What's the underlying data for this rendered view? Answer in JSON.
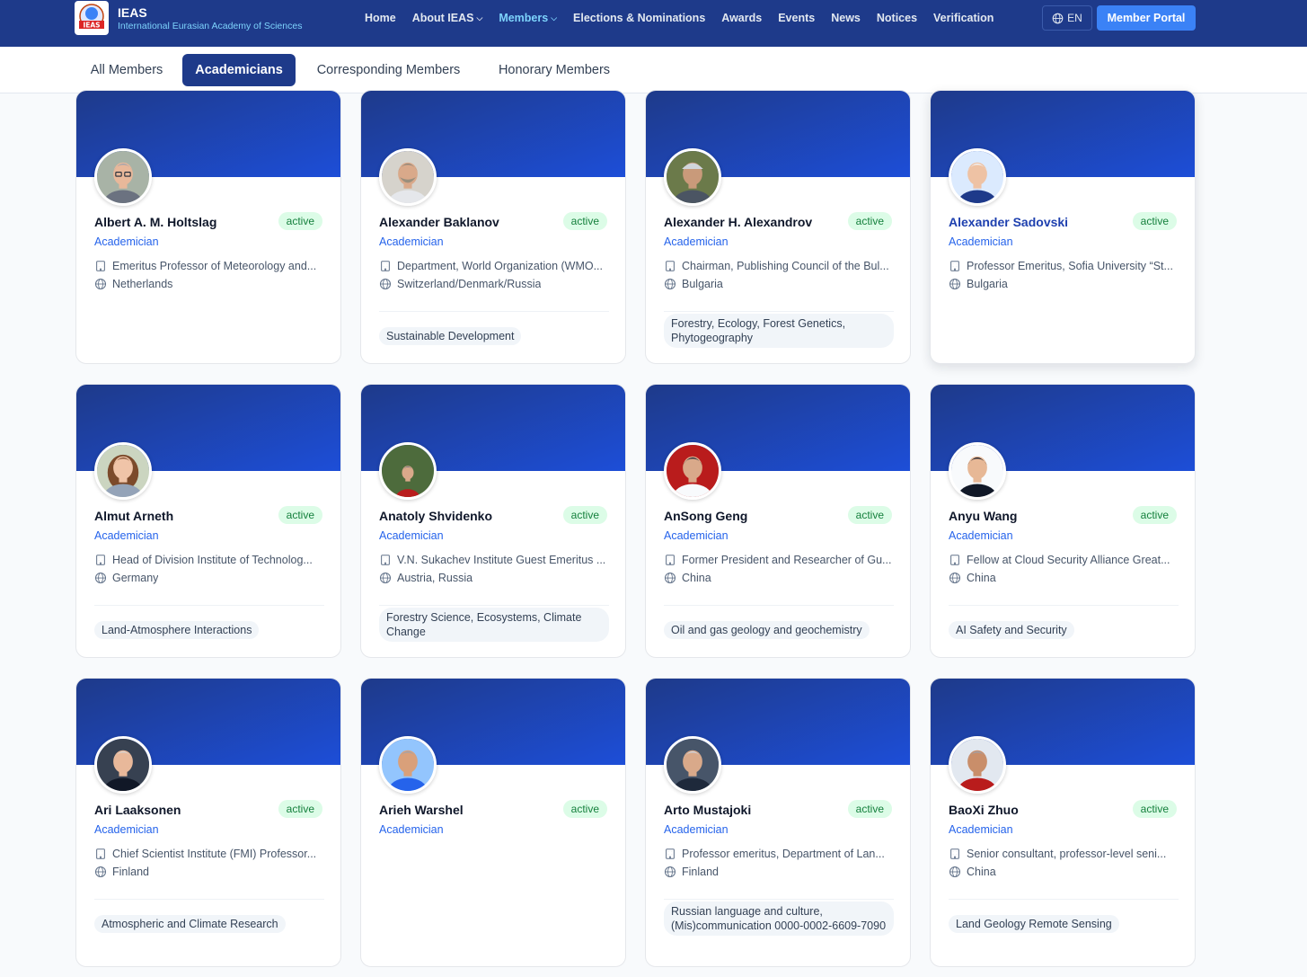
{
  "header": {
    "logo_text": "IEAS",
    "brand_title": "IEAS",
    "brand_subtitle": "International Eurasian Academy of Sciences",
    "nav": [
      {
        "label": "Home",
        "dropdown": false,
        "active": false
      },
      {
        "label": "About IEAS",
        "dropdown": true,
        "active": false
      },
      {
        "label": "Members",
        "dropdown": true,
        "active": true
      },
      {
        "label": "Elections & Nominations",
        "dropdown": false,
        "active": false
      },
      {
        "label": "Awards",
        "dropdown": false,
        "active": false
      },
      {
        "label": "Events",
        "dropdown": false,
        "active": false
      },
      {
        "label": "News",
        "dropdown": false,
        "active": false
      },
      {
        "label": "Notices",
        "dropdown": false,
        "active": false
      },
      {
        "label": "Verification",
        "dropdown": false,
        "active": false
      }
    ],
    "language": "EN",
    "portal_label": "Member Portal"
  },
  "tabs": [
    {
      "label": "All Members",
      "active": false
    },
    {
      "label": "Academicians",
      "active": true
    },
    {
      "label": "Corresponding Members",
      "active": false
    },
    {
      "label": "Honorary Members",
      "active": false
    }
  ],
  "members": [
    {
      "name": "Albert A. M. Holtslag",
      "status": "active",
      "role": "Academician",
      "position": "Emeritus Professor of Meteorology and...",
      "country": "Netherlands",
      "tags": [],
      "avatar": "gray-hair-glasses"
    },
    {
      "name": "Alexander Baklanov",
      "status": "active",
      "role": "Academician",
      "position": "Department, World Organization (WMO...",
      "country": "Switzerland/Denmark/Russia",
      "tags": [
        "Sustainable Development"
      ],
      "avatar": "bald-beard"
    },
    {
      "name": "Alexander H. Alexandrov",
      "status": "active",
      "role": "Academician",
      "position": "Chairman, Publishing Council of the Bul...",
      "country": "Bulgaria",
      "tags": [
        "Forestry, Ecology, Forest Genetics, Phytogeography"
      ],
      "avatar": "outdoor-cap"
    },
    {
      "name": "Alexander Sadovski",
      "status": "active",
      "role": "Academician",
      "position": "Professor Emeritus, Sofia University “St...",
      "country": "Bulgaria",
      "tags": [],
      "avatar": "white-hair-suit"
    },
    {
      "name": "Almut Arneth",
      "status": "active",
      "role": "Academician",
      "position": "Head of Division Institute of Technolog...",
      "country": "Germany",
      "tags": [
        "Land-Atmosphere Interactions"
      ],
      "avatar": "woman-brown-hair"
    },
    {
      "name": "Anatoly Shvidenko",
      "status": "active",
      "role": "Academician",
      "position": "V.N. Sukachev Institute Guest Emeritus ...",
      "country": "Austria, Russia",
      "tags": [
        "Forestry Science, Ecosystems, Climate Change"
      ],
      "avatar": "forest-red-jacket"
    },
    {
      "name": "AnSong Geng",
      "status": "active",
      "role": "Academician",
      "position": "Former President and Researcher of Gu...",
      "country": "China",
      "tags": [
        "Oil and gas geology and geochemistry"
      ],
      "avatar": "red-background"
    },
    {
      "name": "Anyu Wang",
      "status": "active",
      "role": "Academician",
      "position": "Fellow at Cloud Security Alliance Great...",
      "country": "China",
      "tags": [
        "AI Safety and Security"
      ],
      "avatar": "young-dark-hair"
    },
    {
      "name": "Ari Laaksonen",
      "status": "active",
      "role": "Academician",
      "position": "Chief Scientist Institute (FMI) Professor...",
      "country": "Finland",
      "tags": [
        "Atmospheric and Climate Research"
      ],
      "avatar": "dark-suit-smile"
    },
    {
      "name": "Arieh Warshel",
      "status": "active",
      "role": "Academician",
      "position": "",
      "country": "",
      "tags": [],
      "avatar": "gray-hair-blue-shirt"
    },
    {
      "name": "Arto Mustajoki",
      "status": "active",
      "role": "Academician",
      "position": "Professor emeritus, Department of Lan...",
      "country": "Finland",
      "tags": [
        "Russian language and culture, (Mis)communication 0000-0002-6609-7090"
      ],
      "avatar": "side-profile"
    },
    {
      "name": "BaoXi Zhuo",
      "status": "active",
      "role": "Academician",
      "position": "Senior consultant, professor-level seni...",
      "country": "China",
      "tags": [
        "Land Geology Remote Sensing"
      ],
      "avatar": "gray-hair-red-jacket"
    }
  ],
  "icons": {
    "position": "building-icon",
    "country": "globe-icon"
  },
  "colors": {
    "nav_bg": "#1e3a8a",
    "accent": "#3b82f6",
    "badge_bg": "#dcfce7",
    "badge_text": "#15803d",
    "role_text": "#2563eb"
  }
}
